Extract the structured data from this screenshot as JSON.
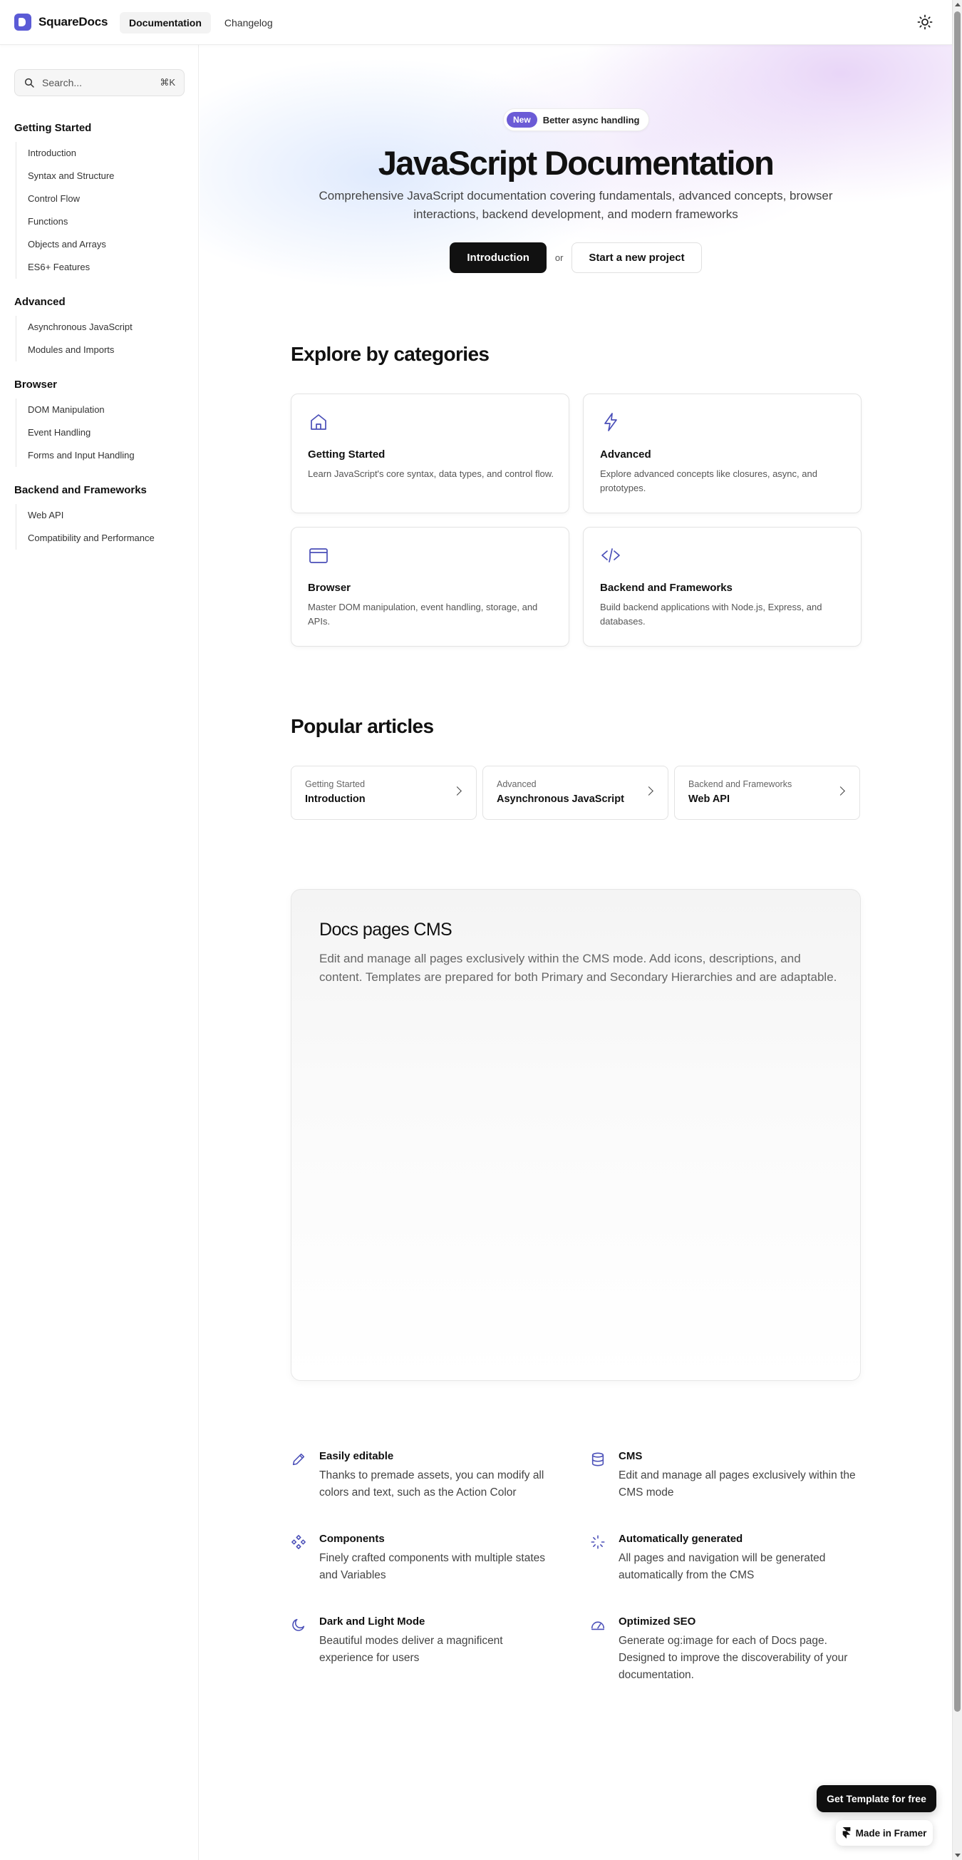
{
  "brand": {
    "name": "SquareDocs"
  },
  "topnav": {
    "items": [
      "Documentation",
      "Changelog"
    ]
  },
  "search": {
    "placeholder": "Search...",
    "shortcut": "⌘K"
  },
  "sidebar": {
    "groups": [
      {
        "title": "Getting Started",
        "items": [
          "Introduction",
          "Syntax and Structure",
          "Control Flow",
          "Functions",
          "Objects and Arrays",
          "ES6+ Features"
        ]
      },
      {
        "title": "Advanced",
        "items": [
          "Asynchronous JavaScript",
          "Modules and Imports"
        ]
      },
      {
        "title": "Browser",
        "items": [
          "DOM Manipulation",
          "Event Handling",
          "Forms and Input Handling"
        ]
      },
      {
        "title": "Backend and Frameworks",
        "items": [
          "Web API",
          "Compatibility and Performance"
        ]
      }
    ]
  },
  "hero": {
    "badge_new": "New",
    "badge_text": "Better async handling",
    "title": "JavaScript Documentation",
    "subtitle": "Comprehensive JavaScript documentation covering fundamentals, advanced concepts, browser interactions, backend development, and modern frameworks",
    "primary_label": "Introduction",
    "or_label": "or",
    "secondary_label": "Start a new project"
  },
  "categories": {
    "title": "Explore by categories",
    "cards": [
      {
        "icon": "home-icon",
        "title": "Getting Started",
        "desc": "Learn JavaScript's core syntax, data types, and control flow."
      },
      {
        "icon": "lightning-icon",
        "title": "Advanced",
        "desc": "Explore advanced concepts like closures, async, and prototypes."
      },
      {
        "icon": "browser-window-icon",
        "title": "Browser",
        "desc": "Master DOM manipulation, event handling, storage, and APIs."
      },
      {
        "icon": "code-icon",
        "title": "Backend and Frameworks",
        "desc": "Build backend applications with Node.js, Express, and databases."
      }
    ]
  },
  "articles": {
    "title": "Popular articles",
    "items": [
      {
        "category": "Getting Started",
        "title": "Introduction"
      },
      {
        "category": "Advanced",
        "title": "Asynchronous JavaScript"
      },
      {
        "category": "Backend and Frameworks",
        "title": "Web API"
      }
    ]
  },
  "cms": {
    "title": "Docs pages CMS",
    "desc": "Edit and manage all pages exclusively within the CMS mode. Add icons, descriptions, and content. Templates are prepared for both Primary and Secondary Hierarchies and are adaptable."
  },
  "features": [
    {
      "icon": "pencil-icon",
      "title": "Easily editable",
      "desc": "Thanks to premade assets, you can modify all colors and text, such as the Action Color"
    },
    {
      "icon": "database-icon",
      "title": "CMS",
      "desc": "Edit and manage all pages exclusively within the CMS mode"
    },
    {
      "icon": "components-icon",
      "title": "Components",
      "desc": "Finely crafted components with multiple states and Variables"
    },
    {
      "icon": "loader-icon",
      "title": "Automatically generated",
      "desc": "All pages and navigation will be generated automatically from the CMS"
    },
    {
      "icon": "moon-icon",
      "title": "Dark and Light Mode",
      "desc": "Beautiful modes deliver a magnificent experience for users"
    },
    {
      "icon": "gauge-icon",
      "title": "Optimized SEO",
      "desc": "Generate og:image for each of Docs page. Designed to improve the discoverability of your documentation."
    }
  ],
  "floating": {
    "get_template": "Get Template for free",
    "made_in_framer": "Made in Framer"
  },
  "colors": {
    "accent": "#5b5bd6",
    "badge": "#6b5bd6",
    "icon_stroke": "#4a4fb8"
  }
}
